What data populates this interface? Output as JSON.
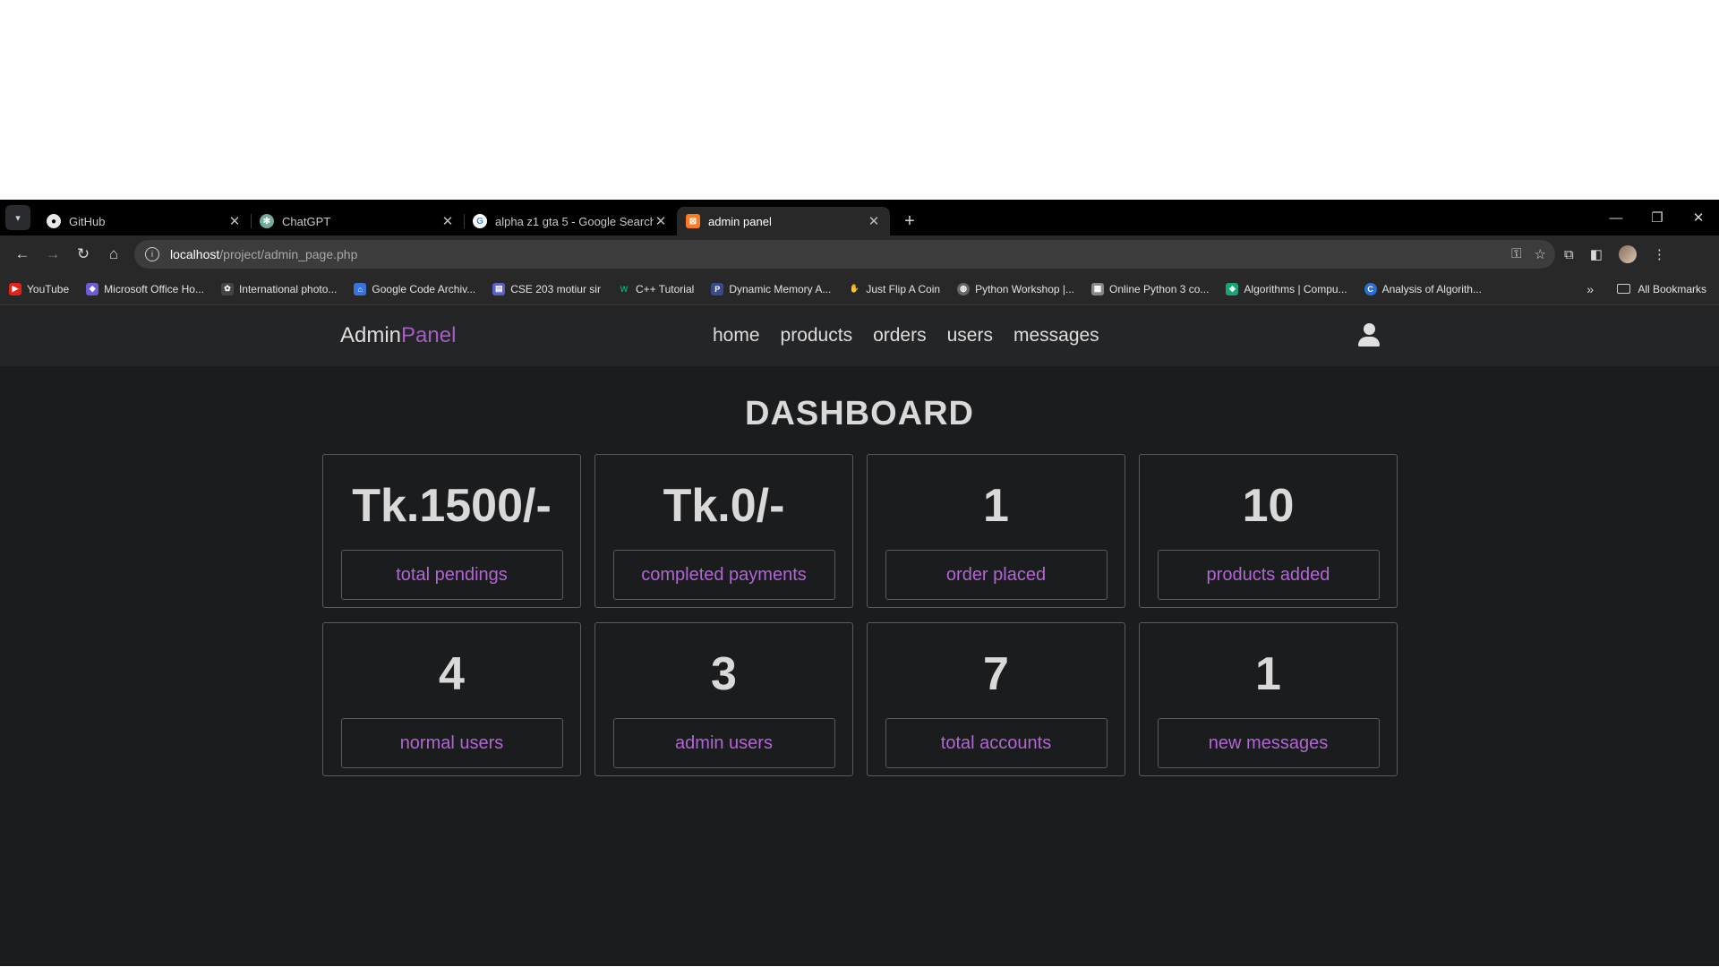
{
  "browser": {
    "tabs": [
      {
        "title": "GitHub",
        "icon": "github-icon",
        "active": false
      },
      {
        "title": "ChatGPT",
        "icon": "chatgpt-icon",
        "active": false
      },
      {
        "title": "alpha z1 gta 5 - Google Search",
        "icon": "google-icon",
        "active": false
      },
      {
        "title": "admin panel",
        "icon": "xampp-icon",
        "active": true
      }
    ],
    "url_host": "localhost",
    "url_path": "/project/admin_page.php",
    "bookmarks": [
      {
        "label": "YouTube",
        "icon": "youtube-icon",
        "color": "#e62117"
      },
      {
        "label": "Microsoft Office Ho...",
        "icon": "office-icon",
        "color": "#6c5bd4"
      },
      {
        "label": "International photo...",
        "icon": "photo-icon",
        "color": "#444444"
      },
      {
        "label": "Google Code Archiv...",
        "icon": "google-code-icon",
        "color": "#3b73d9"
      },
      {
        "label": "CSE 203 motiur sir",
        "icon": "form-icon",
        "color": "#5b5fc7"
      },
      {
        "label": "C++ Tutorial",
        "icon": "w3-icon",
        "color": "#04aa6d"
      },
      {
        "label": "Dynamic Memory A...",
        "icon": "dm-icon",
        "color": "#3a4a8a"
      },
      {
        "label": "Just Flip A Coin",
        "icon": "coin-icon",
        "color": "#c8a040"
      },
      {
        "label": "Python Workshop |...",
        "icon": "globe-icon",
        "color": "#666666"
      },
      {
        "label": "Online Python 3 co...",
        "icon": "python-icon",
        "color": "#888888"
      },
      {
        "label": "Algorithms | Compu...",
        "icon": "algo-icon",
        "color": "#1aa37a"
      },
      {
        "label": "Analysis of Algorith...",
        "icon": "c-icon",
        "color": "#2a6fd6"
      }
    ],
    "all_bookmarks": "All Bookmarks"
  },
  "header": {
    "logo_main": "Admin",
    "logo_accent": "Panel",
    "nav": [
      "home",
      "products",
      "orders",
      "users",
      "messages"
    ]
  },
  "dashboard": {
    "title": "DASHBOARD",
    "cards": [
      {
        "value": "Tk.1500/-",
        "label": "total pendings"
      },
      {
        "value": "Tk.0/-",
        "label": "completed payments"
      },
      {
        "value": "1",
        "label": "order placed"
      },
      {
        "value": "10",
        "label": "products added"
      },
      {
        "value": "4",
        "label": "normal users"
      },
      {
        "value": "3",
        "label": "admin users"
      },
      {
        "value": "7",
        "label": "total accounts"
      },
      {
        "value": "1",
        "label": "new messages"
      }
    ]
  },
  "colors": {
    "accent": "#a55ec4",
    "page_bg": "#1b1c1e",
    "header_bg": "#242527"
  }
}
